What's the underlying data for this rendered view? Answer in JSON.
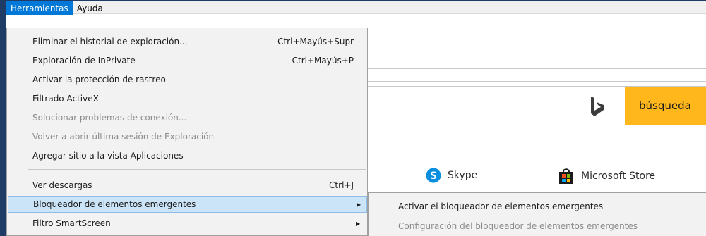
{
  "menubar": {
    "items": [
      {
        "label": "Herramientas",
        "active": true
      },
      {
        "label": "Ayuda",
        "active": false
      }
    ]
  },
  "tools_menu": {
    "items": [
      {
        "label": "Eliminar el historial de exploración...",
        "shortcut": "Ctrl+Mayús+Supr"
      },
      {
        "label": "Exploración de InPrivate",
        "shortcut": "Ctrl+Mayús+P"
      },
      {
        "label": "Activar la protección de rastreo"
      },
      {
        "label": "Filtrado ActiveX"
      },
      {
        "label": "Solucionar problemas de conexión...",
        "disabled": true
      },
      {
        "label": "Volver a abrir última sesión de Exploración",
        "disabled": true
      },
      {
        "label": "Agregar sitio a la vista Aplicaciones"
      },
      {
        "label": "Ver descargas",
        "shortcut": "Ctrl+J"
      },
      {
        "label": "Bloqueador de elementos emergentes",
        "submenu": true,
        "highlighted": true
      },
      {
        "label": "Filtro SmartScreen",
        "submenu": true
      }
    ]
  },
  "popup_submenu": {
    "items": [
      {
        "label": "Activar el bloqueador de elementos emergentes"
      },
      {
        "label": "Configuración del bloqueador de elementos emergentes",
        "disabled": true
      }
    ]
  },
  "page": {
    "search_button": "búsqueda",
    "tiles": [
      {
        "label": "Skype",
        "icon": "skype-icon"
      },
      {
        "label": "Microsoft Store",
        "icon": "store-icon"
      }
    ]
  },
  "colors": {
    "menubar_active": "#0078d7",
    "menu_bg": "#f2f2f2",
    "hover_bg": "#cce4f7",
    "search_button": "#ffb71c",
    "frame": "#1e3c66"
  }
}
